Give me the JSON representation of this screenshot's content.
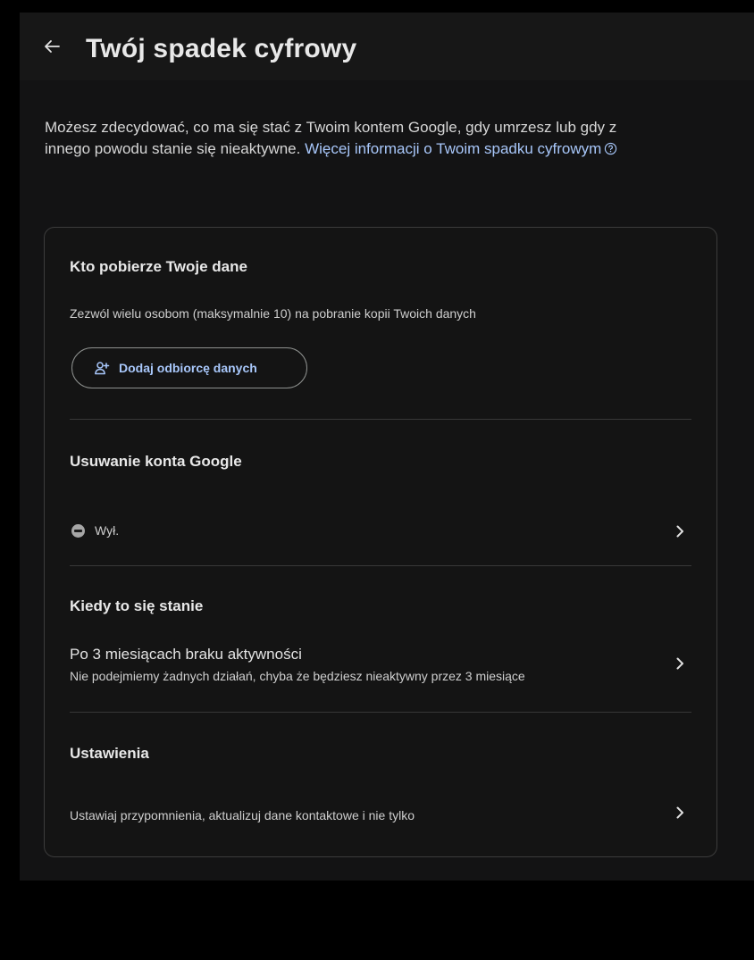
{
  "header": {
    "back_icon": "arrow-back-icon",
    "title": "Twój spadek cyfrowy"
  },
  "intro": {
    "text": "Możesz zdecydować, co ma się stać z Twoim kontem Google, gdy umrzesz lub gdy z innego powodu stanie się nieaktywne. ",
    "link": "Więcej informacji o Twoim spadku cyfrowym",
    "link_icon": "help-circle-icon"
  },
  "sections": {
    "data_recipients": {
      "title": "Kto pobierze Twoje dane",
      "description": "Zezwól wielu osobom (maksymalnie 10) na pobranie kopii Twoich danych",
      "button_label": "Dodaj odbiorcę danych",
      "button_icon": "person-add-icon"
    },
    "account_deletion": {
      "title": "Usuwanie konta Google",
      "status": "Wył.",
      "status_icon": "off-status-icon"
    },
    "when": {
      "title": "Kiedy to się stanie",
      "value": "Po 3 miesiącach braku aktywności",
      "description": "Nie podejmiemy żadnych działań, chyba że będziesz nieaktywny przez 3 miesiące"
    },
    "settings": {
      "title": "Ustawienia",
      "description": "Ustawiaj przypomnienia, aktualizuj dane kontaktowe i nie tylko"
    }
  },
  "colors": {
    "background": "#131314",
    "header": "#171717",
    "text": "#e3e3e3",
    "link": "#a8c7fa",
    "border": "#3c3c3c"
  }
}
